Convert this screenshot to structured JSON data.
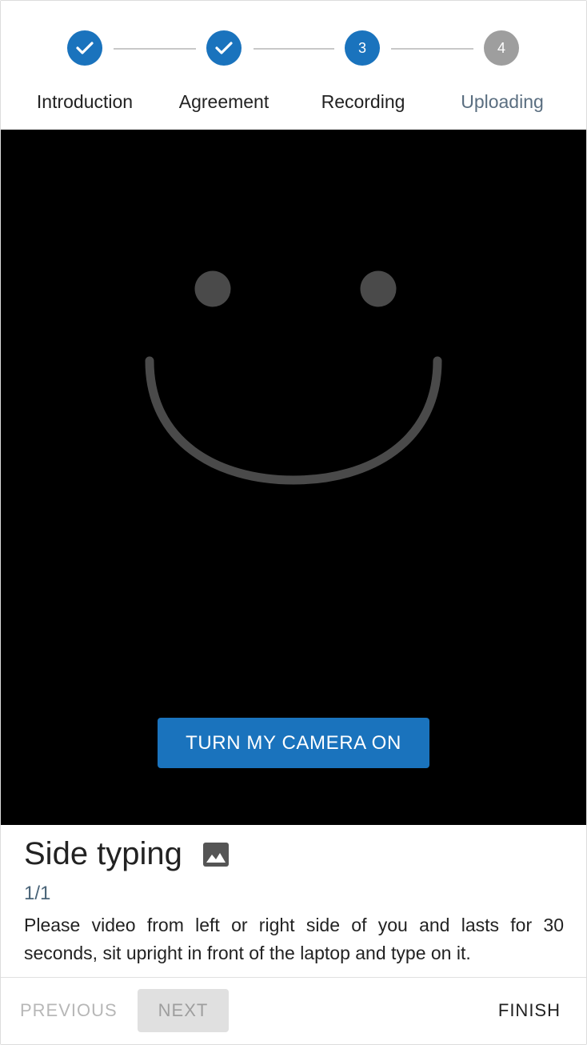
{
  "stepper": {
    "steps": [
      {
        "label": "Introduction",
        "number": "1",
        "status": "done"
      },
      {
        "label": "Agreement",
        "number": "2",
        "status": "done"
      },
      {
        "label": "Recording",
        "number": "3",
        "status": "active"
      },
      {
        "label": "Uploading",
        "number": "4",
        "status": "pending"
      }
    ]
  },
  "video": {
    "placeholder_icon": "smiley-face-icon",
    "camera_button_label": "TURN MY CAMERA ON"
  },
  "task": {
    "title": "Side typing",
    "title_icon": "image-icon",
    "counter": "1/1",
    "description": "Please video from left or right side of you and lasts for 30 seconds, sit upright in front of the laptop and type on it."
  },
  "footer": {
    "previous_label": "PREVIOUS",
    "next_label": "NEXT",
    "finish_label": "FINISH"
  },
  "colors": {
    "accent": "#1a73bd",
    "pending_step": "#9e9e9e",
    "video_bg": "#000000",
    "smiley": "#4a4a4a"
  }
}
